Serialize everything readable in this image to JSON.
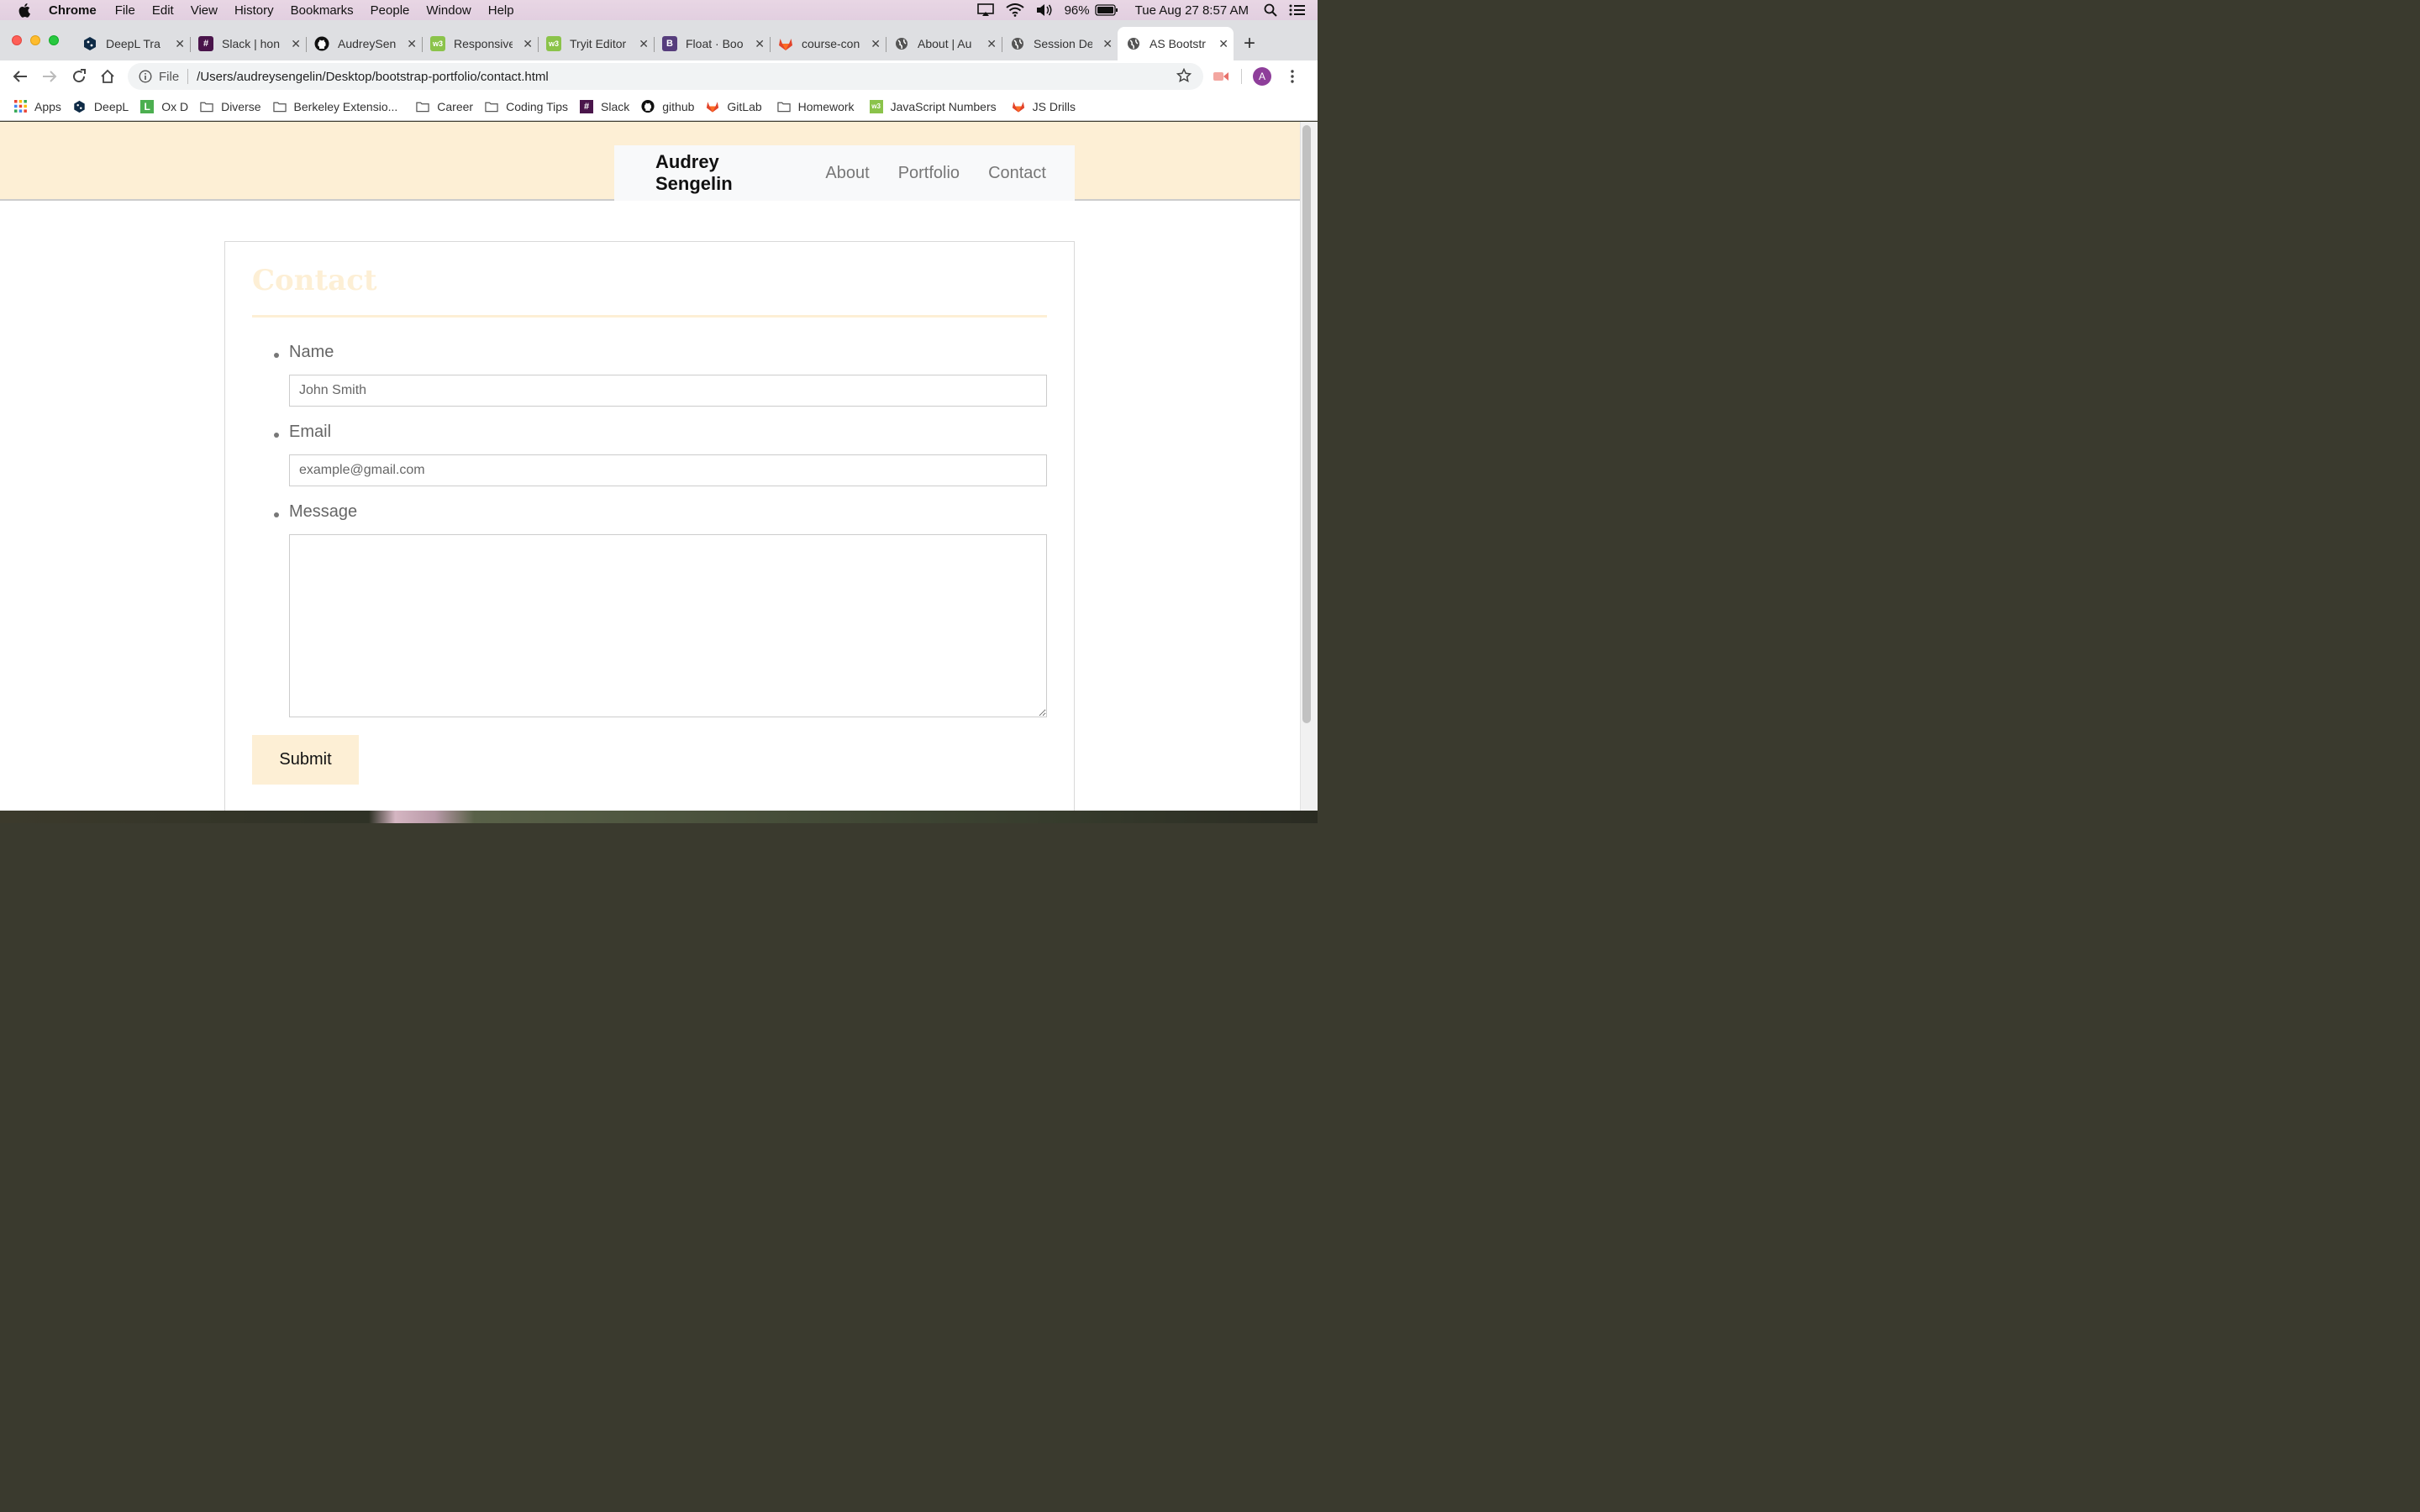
{
  "menubar": {
    "app": "Chrome",
    "items": [
      "File",
      "Edit",
      "View",
      "History",
      "Bookmarks",
      "People",
      "Window",
      "Help"
    ],
    "battery": "96%",
    "clock": "Tue Aug 27  8:57 AM"
  },
  "tabs": [
    {
      "title": "DeepL Tra",
      "favicon_color": "#0f2b46",
      "favicon": "deepl-icon"
    },
    {
      "title": "Slack | hon",
      "favicon_color": "#4a154b",
      "favicon": "slack-icon"
    },
    {
      "title": "AudreySen",
      "favicon_color": "#111111",
      "favicon": "github-icon"
    },
    {
      "title": "Responsive",
      "favicon_color": "#8bc34a",
      "favicon": "w3schools-icon"
    },
    {
      "title": "Tryit Editor",
      "favicon_color": "#8bc34a",
      "favicon": "w3schools-icon"
    },
    {
      "title": "Float · Boo",
      "favicon_color": "#563d7c",
      "favicon": "bootstrap-icon"
    },
    {
      "title": "course-con",
      "favicon_color": "#e24329",
      "favicon": "gitlab-icon"
    },
    {
      "title": "About | Au",
      "favicon_color": "#555555",
      "favicon": "globe-icon"
    },
    {
      "title": "Session De",
      "favicon_color": "#555555",
      "favicon": "globe-icon"
    },
    {
      "title": "AS Bootstr",
      "favicon_color": "#555555",
      "favicon": "globe-icon",
      "active": true
    }
  ],
  "omnibox": {
    "scheme_label": "File",
    "url": "/Users/audreysengelin/Desktop/bootstrap-portfolio/contact.html"
  },
  "profile_initial": "A",
  "bookmarks": [
    {
      "label": "Apps",
      "icon": "apps-grid-icon"
    },
    {
      "label": "DeepL",
      "icon": "deepl-icon"
    },
    {
      "label": "Ox D",
      "icon": "ox-icon"
    },
    {
      "label": "Diverse",
      "icon": "folder-icon"
    },
    {
      "label": "Berkeley Extensio...",
      "icon": "folder-icon"
    },
    {
      "label": "Career",
      "icon": "folder-icon"
    },
    {
      "label": "Coding Tips",
      "icon": "folder-icon"
    },
    {
      "label": "Slack",
      "icon": "slack-icon"
    },
    {
      "label": "github",
      "icon": "github-icon"
    },
    {
      "label": "GitLab",
      "icon": "gitlab-icon"
    },
    {
      "label": "Homework",
      "icon": "folder-icon"
    },
    {
      "label": "JavaScript Numbers",
      "icon": "w3schools-icon"
    },
    {
      "label": "JS Drills",
      "icon": "gitlab-icon"
    }
  ],
  "site": {
    "brand": "Audrey Sengelin",
    "nav": [
      "About",
      "Portfolio",
      "Contact"
    ],
    "accent_color": "#fdefd5",
    "heading": "Contact",
    "form": {
      "name_label": "Name",
      "name_placeholder": "John Smith",
      "email_label": "Email",
      "email_placeholder": "example@gmail.com",
      "message_label": "Message",
      "message_placeholder": "",
      "submit_label": "Submit"
    }
  }
}
